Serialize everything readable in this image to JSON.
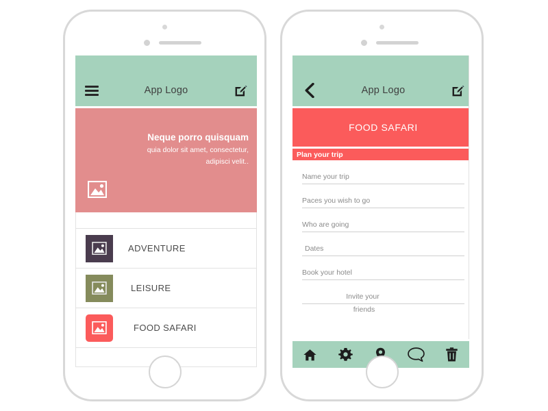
{
  "colors": {
    "mint": "#a5d2bc",
    "hero_salmon": "#e28d8d",
    "coral": "#fb5b5b",
    "frame_gray": "#d8d8d8",
    "thumb_adventure": "#4a3c4e",
    "thumb_leisure": "#858b5c",
    "thumb_food": "#fb5b5b"
  },
  "phone1": {
    "appbar": {
      "menu_icon": "hamburger-icon",
      "title": "App Logo",
      "edit_icon": "edit-square-pencil-icon"
    },
    "hero": {
      "title": "Neque porro quisquam",
      "sub_line1": "quia dolor sit amet, consectetur,",
      "sub_line2": "adipisci velit..",
      "thumb_icon": "image-placeholder-icon"
    },
    "list": [
      {
        "label": "ADVENTURE",
        "thumb_icon": "image-placeholder-icon",
        "color": "#4a3c4e"
      },
      {
        "label": "LEISURE",
        "thumb_icon": "image-placeholder-icon",
        "color": "#858b5c"
      },
      {
        "label": "FOOD SAFARI",
        "thumb_icon": "image-placeholder-icon",
        "color": "#fb5b5b"
      }
    ]
  },
  "phone2": {
    "appbar": {
      "back_icon": "chevron-left-icon",
      "title": "App Logo",
      "edit_icon": "edit-square-pencil-icon"
    },
    "banner": "FOOD SAFARI",
    "section_header": "Plan your trip",
    "fields": [
      {
        "label": "Name your trip"
      },
      {
        "label": "Paces you wish to go"
      },
      {
        "label": "Who are going"
      },
      {
        "label": "Dates"
      },
      {
        "label": "Book your hotel"
      },
      {
        "label": "Invite your",
        "label_overflow": "friends"
      }
    ],
    "tabbar": [
      {
        "icon": "home-icon"
      },
      {
        "icon": "gear-icon"
      },
      {
        "icon": "location-pin-icon"
      },
      {
        "icon": "chat-bubble-icon"
      },
      {
        "icon": "trash-icon"
      }
    ]
  }
}
